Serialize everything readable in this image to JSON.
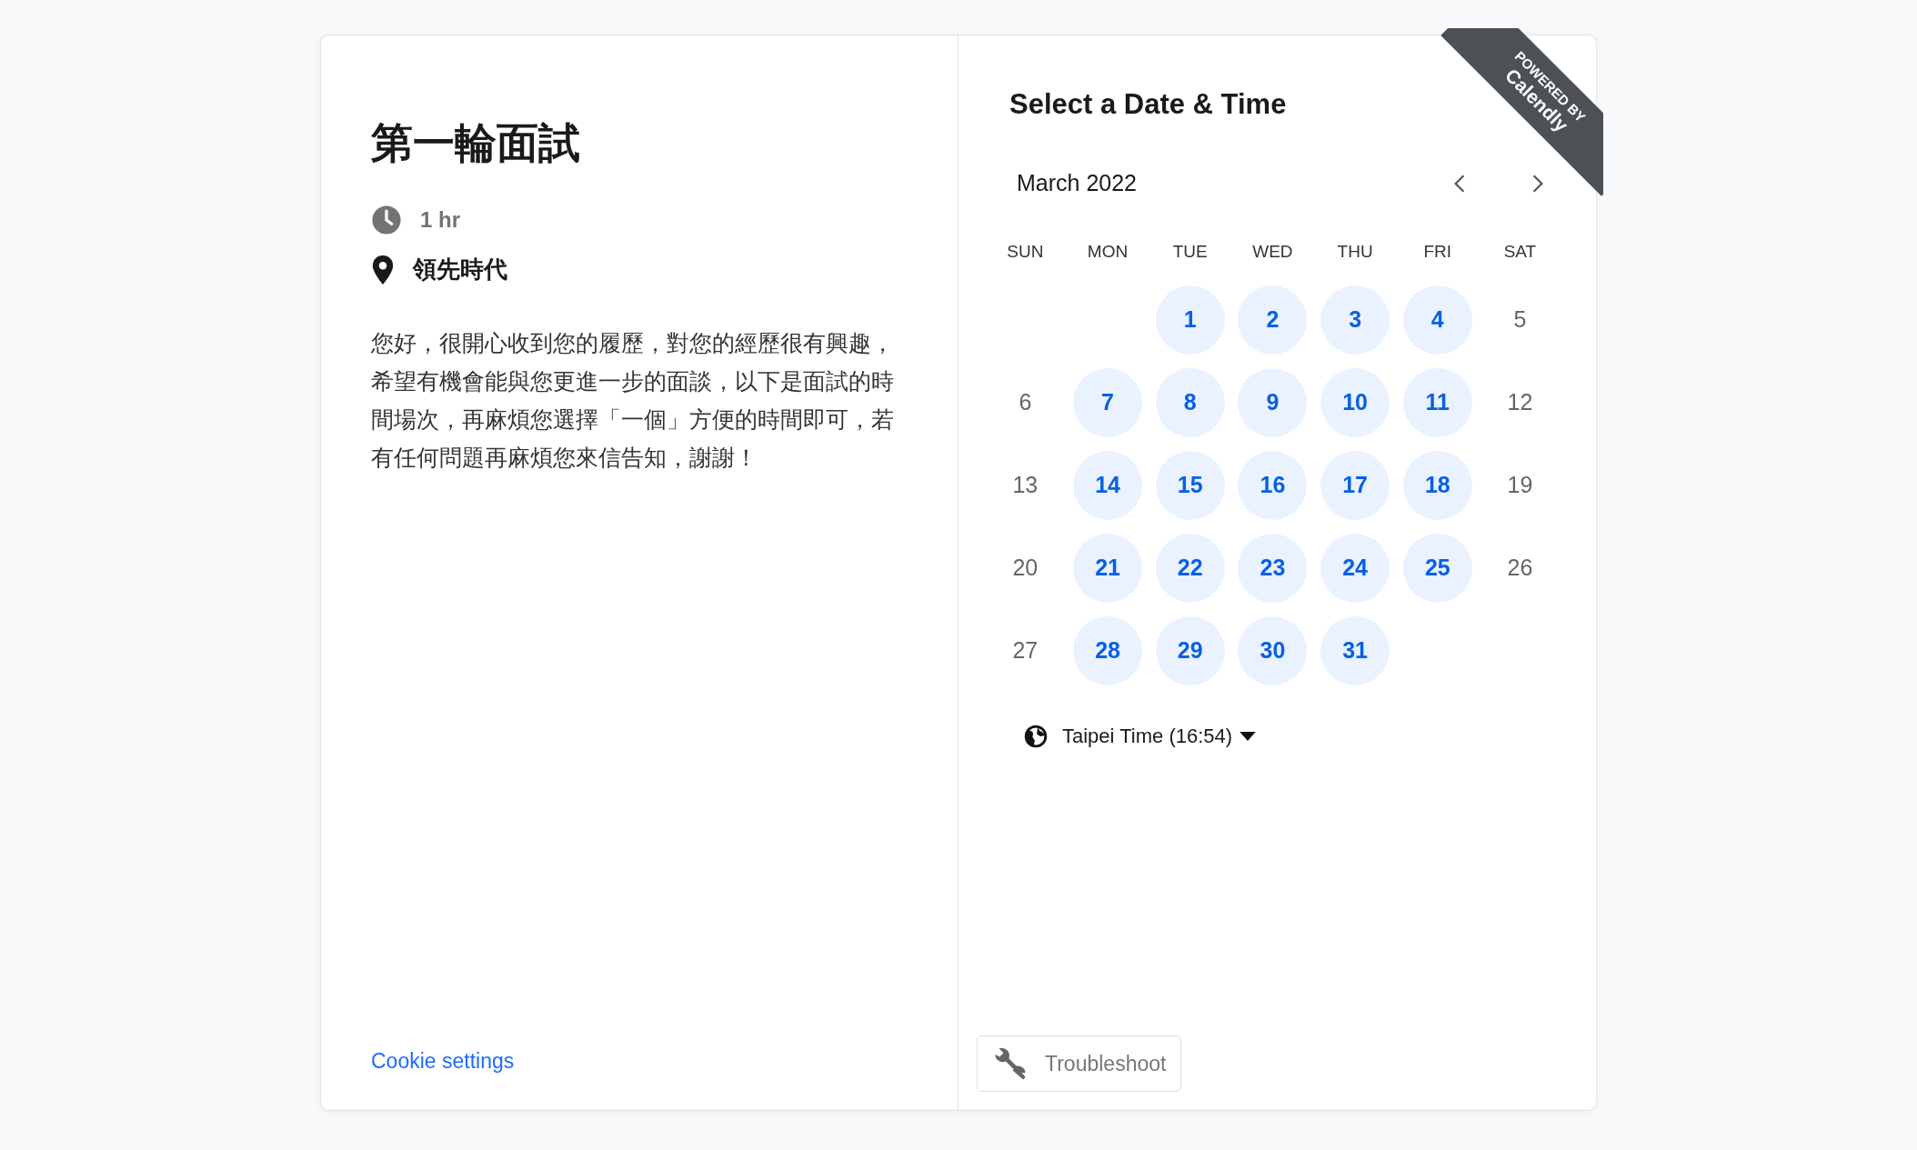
{
  "event": {
    "title": "第一輪面試",
    "duration": "1 hr",
    "location": "領先時代",
    "description": "您好，很開心收到您的履歷，對您的經歷很有興趣，希望有機會能與您更進一步的面談，以下是面試的時間場次，再麻煩您選擇「一個」方便的時間即可，若有任何問題再麻煩您來信告知，謝謝！"
  },
  "cookie_link": "Cookie settings",
  "ribbon": {
    "line1": "POWERED BY",
    "line2": "Calendly"
  },
  "heading": "Select a Date & Time",
  "calendar": {
    "month": "March 2022",
    "weekdays": [
      "SUN",
      "MON",
      "TUE",
      "WED",
      "THU",
      "FRI",
      "SAT"
    ],
    "weeks": [
      [
        {
          "kind": "empty"
        },
        {
          "kind": "empty"
        },
        {
          "kind": "day",
          "day": "1",
          "available": true
        },
        {
          "kind": "day",
          "day": "2",
          "available": true
        },
        {
          "kind": "day",
          "day": "3",
          "available": true
        },
        {
          "kind": "day",
          "day": "4",
          "available": true
        },
        {
          "kind": "day",
          "day": "5",
          "available": false
        }
      ],
      [
        {
          "kind": "day",
          "day": "6",
          "available": false
        },
        {
          "kind": "day",
          "day": "7",
          "available": true
        },
        {
          "kind": "day",
          "day": "8",
          "available": true
        },
        {
          "kind": "day",
          "day": "9",
          "available": true
        },
        {
          "kind": "day",
          "day": "10",
          "available": true
        },
        {
          "kind": "day",
          "day": "11",
          "available": true
        },
        {
          "kind": "day",
          "day": "12",
          "available": false
        }
      ],
      [
        {
          "kind": "day",
          "day": "13",
          "available": false
        },
        {
          "kind": "day",
          "day": "14",
          "available": true
        },
        {
          "kind": "day",
          "day": "15",
          "available": true
        },
        {
          "kind": "day",
          "day": "16",
          "available": true
        },
        {
          "kind": "day",
          "day": "17",
          "available": true
        },
        {
          "kind": "day",
          "day": "18",
          "available": true
        },
        {
          "kind": "day",
          "day": "19",
          "available": false
        }
      ],
      [
        {
          "kind": "day",
          "day": "20",
          "available": false
        },
        {
          "kind": "day",
          "day": "21",
          "available": true
        },
        {
          "kind": "day",
          "day": "22",
          "available": true
        },
        {
          "kind": "day",
          "day": "23",
          "available": true
        },
        {
          "kind": "day",
          "day": "24",
          "available": true
        },
        {
          "kind": "day",
          "day": "25",
          "available": true
        },
        {
          "kind": "day",
          "day": "26",
          "available": false
        }
      ],
      [
        {
          "kind": "day",
          "day": "27",
          "available": false
        },
        {
          "kind": "day",
          "day": "28",
          "available": true
        },
        {
          "kind": "day",
          "day": "29",
          "available": true
        },
        {
          "kind": "day",
          "day": "30",
          "available": true
        },
        {
          "kind": "day",
          "day": "31",
          "available": true
        },
        {
          "kind": "empty"
        },
        {
          "kind": "empty"
        }
      ]
    ]
  },
  "timezone": "Taipei Time (16:54)",
  "troubleshoot": "Troubleshoot"
}
